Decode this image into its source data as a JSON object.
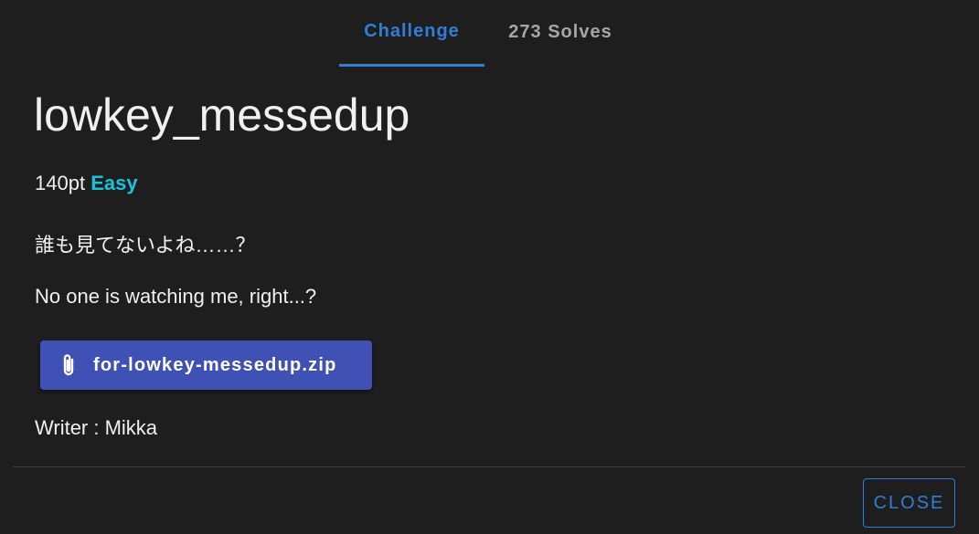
{
  "tabs": [
    {
      "label": "Challenge",
      "active": true
    },
    {
      "label": "273 Solves",
      "active": false
    }
  ],
  "challenge": {
    "title": "lowkey_messedup",
    "points": "140pt",
    "difficulty": "Easy",
    "description_ja": "誰も見てないよね……？",
    "description_en": "No one is watching me, right...?",
    "attachment": {
      "filename": "for-lowkey-messedup.zip",
      "icon": "paperclip-icon"
    },
    "writer": "Writer : Mikka"
  },
  "actions": {
    "close_label": "CLOSE"
  },
  "colors": {
    "background": "#1e1e1e",
    "accent": "#2f7fd6",
    "difficulty_easy": "#19c2dc",
    "download_button": "#3f51b5",
    "text": "#f0f0f0",
    "inactive_tab": "#a6a6a6"
  }
}
